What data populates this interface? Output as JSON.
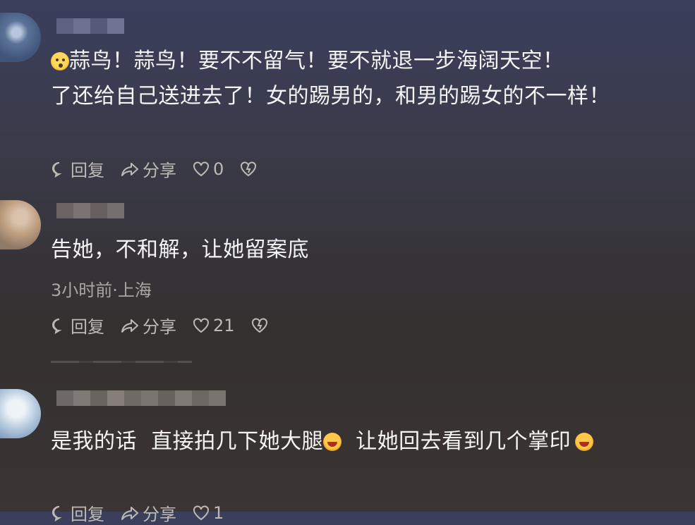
{
  "comments": [
    {
      "lines": [
        "蒜鸟！蒜鸟！要不不留气！要不就退一步海阔天空！",
        "了还给自己送进去了！女的踢男的，和男的踢女的不一样！"
      ],
      "actions": {
        "reply": "回复",
        "share": "分享",
        "likes": "0"
      }
    },
    {
      "lines": [
        "告她，不和解，让她留案底"
      ],
      "meta": "3小时前·上海",
      "actions": {
        "reply": "回复",
        "share": "分享",
        "likes": "21"
      }
    },
    {
      "segments": [
        "是我的话  直接拍几下她大腿",
        "  让她回去看到几个掌印"
      ],
      "actions": {
        "reply": "回复",
        "share": "分享",
        "likes": "1"
      }
    }
  ],
  "icons": {
    "emoji_sweat": "anguished-face-emoji",
    "emoji_laugh": "laughing-face-emoji",
    "reply": "comment-bubble-icon",
    "share": "share-arrow-icon",
    "like": "heart-icon",
    "dislike": "broken-heart-icon"
  }
}
